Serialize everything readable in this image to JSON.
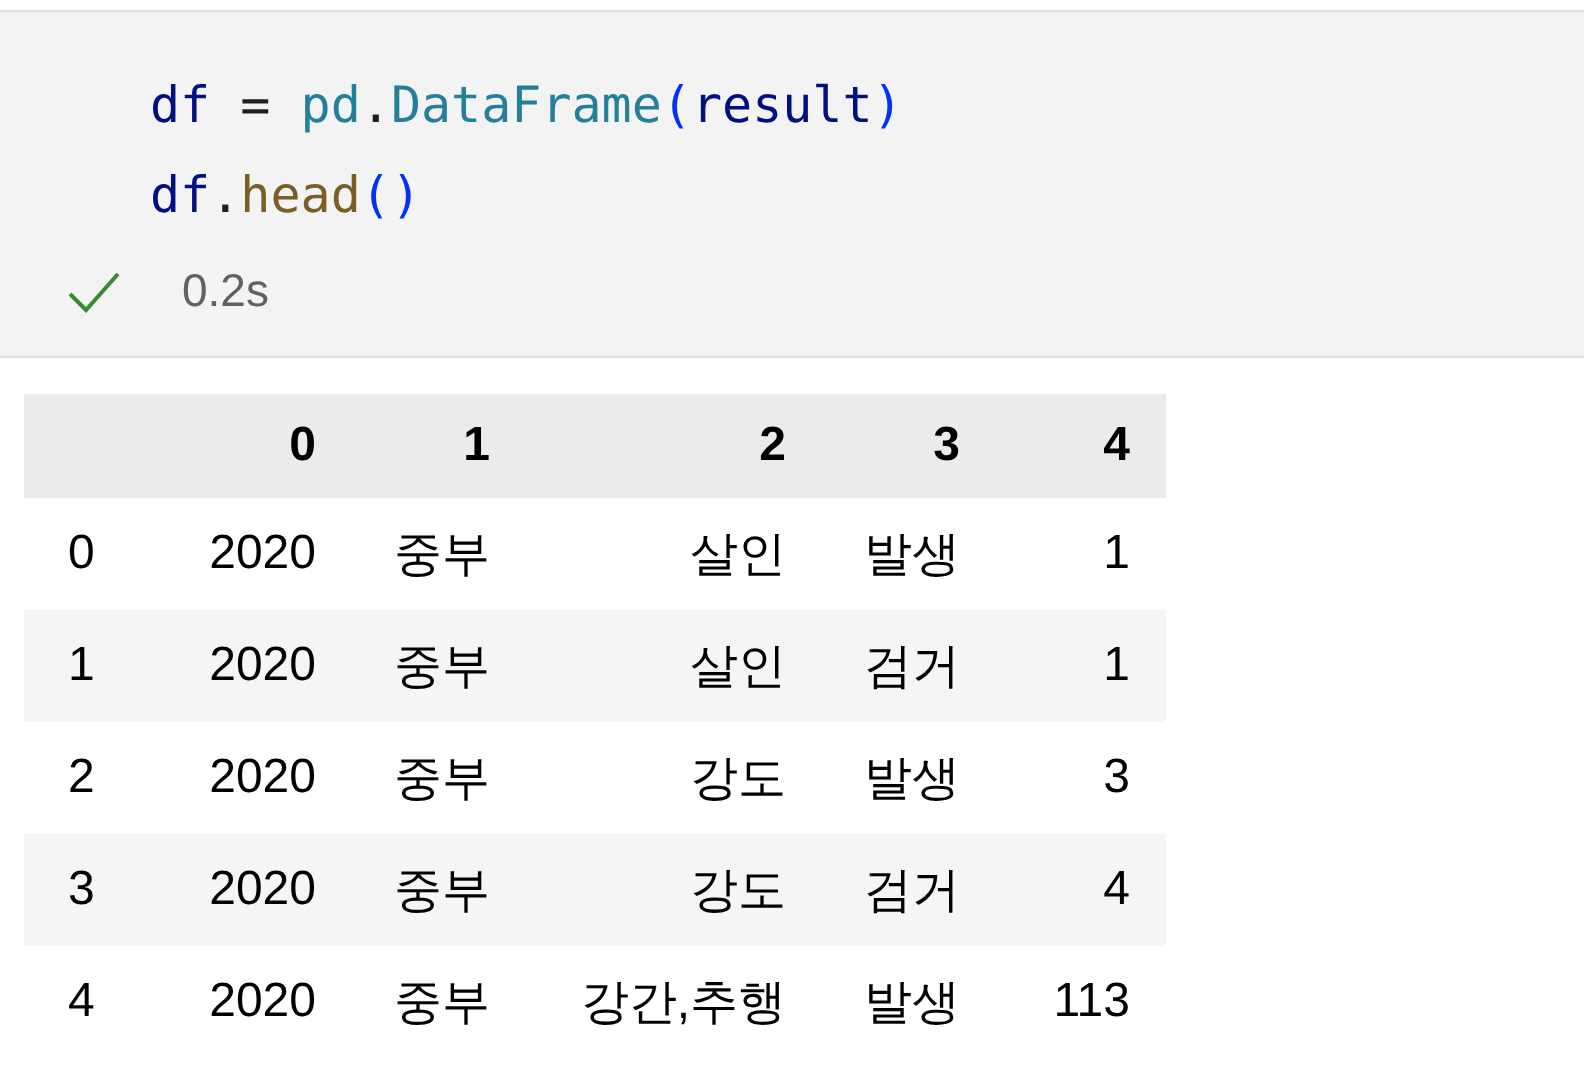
{
  "code_cell": {
    "lines": [
      [
        {
          "text": "df",
          "kind": "variable"
        },
        {
          "text": " = ",
          "kind": "operator"
        },
        {
          "text": "pd",
          "kind": "class"
        },
        {
          "text": ".",
          "kind": "operator"
        },
        {
          "text": "DataFrame",
          "kind": "class"
        },
        {
          "text": "(",
          "kind": "paren"
        },
        {
          "text": "result",
          "kind": "variable"
        },
        {
          "text": ")",
          "kind": "paren"
        }
      ],
      [
        {
          "text": "df",
          "kind": "variable"
        },
        {
          "text": ".",
          "kind": "operator"
        },
        {
          "text": "head",
          "kind": "function"
        },
        {
          "text": "()",
          "kind": "paren"
        }
      ]
    ],
    "succeeded": true,
    "duration": "0.2s"
  },
  "table": {
    "columns": [
      "",
      "0",
      "1",
      "2",
      "3",
      "4"
    ],
    "rows": [
      [
        "0",
        "2020",
        "중부",
        "살인",
        "발생",
        "1"
      ],
      [
        "1",
        "2020",
        "중부",
        "살인",
        "검거",
        "1"
      ],
      [
        "2",
        "2020",
        "중부",
        "강도",
        "발생",
        "3"
      ],
      [
        "3",
        "2020",
        "중부",
        "강도",
        "검거",
        "4"
      ],
      [
        "4",
        "2020",
        "중부",
        "강간,추행",
        "발생",
        "113"
      ]
    ]
  }
}
